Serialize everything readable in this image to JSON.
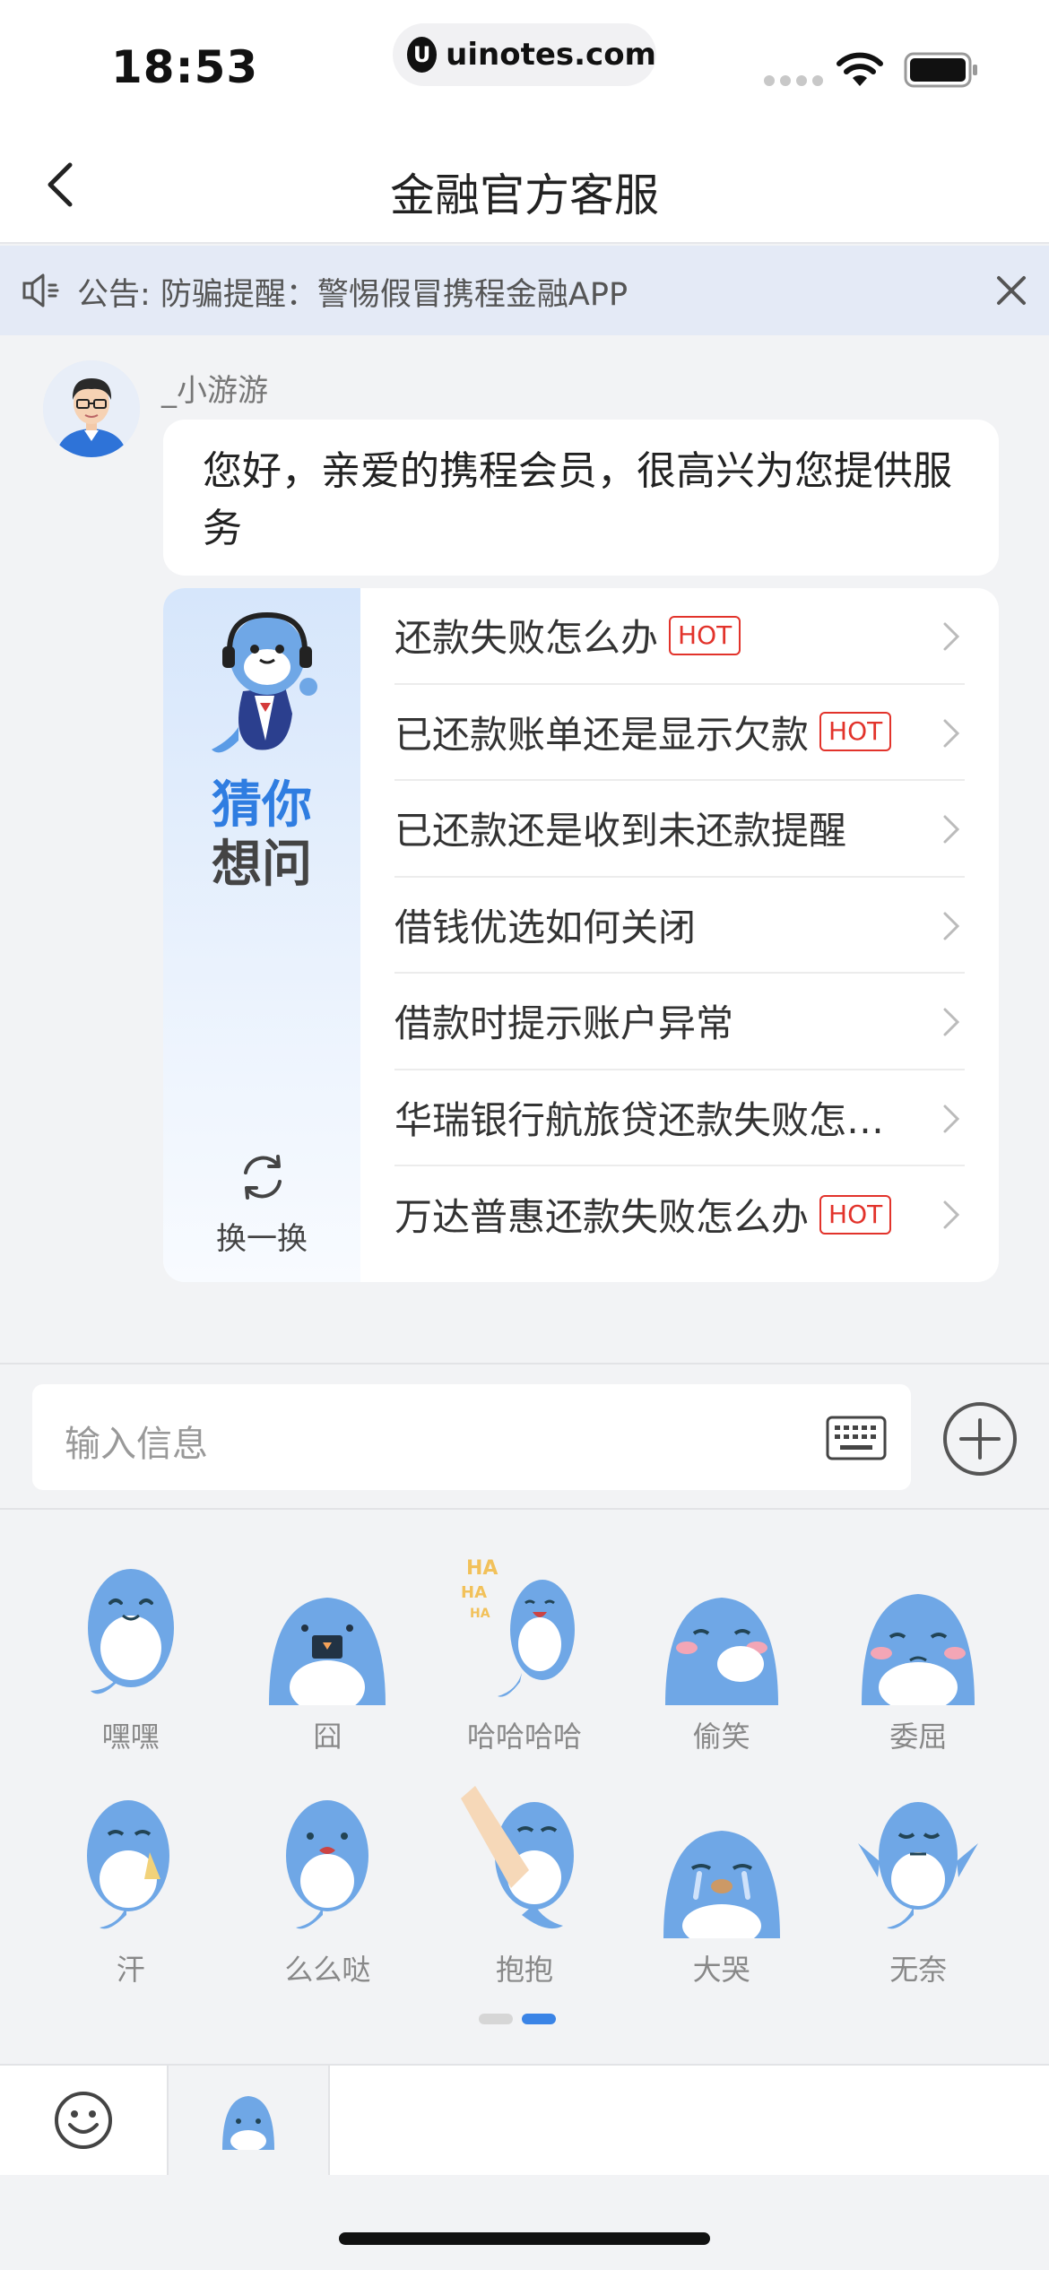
{
  "status_bar": {
    "time": "18:53",
    "url": "uinotes.com"
  },
  "nav": {
    "title": "金融官方客服"
  },
  "notice": {
    "text": "公告: 防骗提醒：警惕假冒携程金融APP"
  },
  "chat": {
    "agent_name": "_小游游",
    "greeting": "您好，亲爱的携程会员，很高兴为您提供服务"
  },
  "faq": {
    "guess_line1": "猜你",
    "guess_line2": "想问",
    "refresh_label": "换一换",
    "hot_label": "HOT",
    "items": [
      {
        "q": "还款失败怎么办",
        "hot": true
      },
      {
        "q": "已还款账单还是显示欠款",
        "hot": true
      },
      {
        "q": "已还款还是收到未还款提醒",
        "hot": false
      },
      {
        "q": "借钱优选如何关闭",
        "hot": false
      },
      {
        "q": "借款时提示账户异常",
        "hot": false
      },
      {
        "q": "华瑞银行航旅贷还款失败怎么办",
        "hot": false
      },
      {
        "q": "万达普惠还款失败怎么办",
        "hot": true
      }
    ]
  },
  "input": {
    "placeholder": "输入信息"
  },
  "stickers": {
    "items": [
      {
        "label": "嘿嘿",
        "icon": "dolphin-hehe-icon"
      },
      {
        "label": "囧",
        "icon": "dolphin-jiong-icon"
      },
      {
        "label": "哈哈哈哈",
        "icon": "dolphin-haha-icon"
      },
      {
        "label": "偷笑",
        "icon": "dolphin-snicker-icon"
      },
      {
        "label": "委屈",
        "icon": "dolphin-wronged-icon"
      },
      {
        "label": "汗",
        "icon": "dolphin-sweat-icon"
      },
      {
        "label": "么么哒",
        "icon": "dolphin-kiss-icon"
      },
      {
        "label": "抱抱",
        "icon": "dolphin-hug-icon"
      },
      {
        "label": "大哭",
        "icon": "dolphin-cry-icon"
      },
      {
        "label": "无奈",
        "icon": "dolphin-helpless-icon"
      }
    ],
    "page_current": 2,
    "page_total": 2
  },
  "colors": {
    "accent": "#3a84e6",
    "hot": "#e2332b",
    "dolphin": "#6fa7e6"
  }
}
